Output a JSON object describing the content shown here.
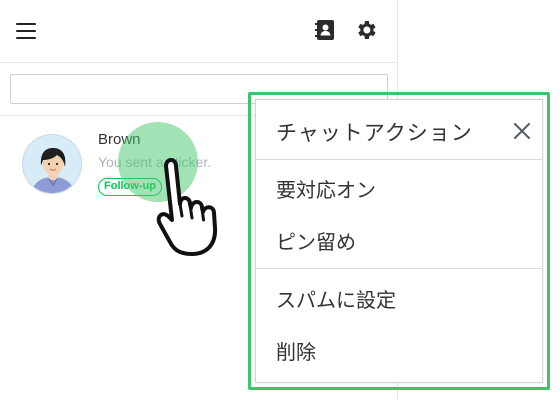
{
  "chat": {
    "name": "Brown",
    "preview": "You sent a sticker.",
    "tag": "Follow-up"
  },
  "search": {
    "placeholder": "",
    "value": ""
  },
  "icons": {
    "menu": "hamburger-icon",
    "contacts": "contact-book-icon",
    "settings": "gear-icon",
    "close": "close-icon",
    "pointer": "tap-hand-icon"
  },
  "context_menu": {
    "title": "チャットアクション",
    "group1": [
      "要対応オン",
      "ピン留め"
    ],
    "group2": [
      "スパムに設定",
      "削除"
    ]
  },
  "colors": {
    "accent_green": "#06c755",
    "highlight_green": "#3cc56b"
  }
}
